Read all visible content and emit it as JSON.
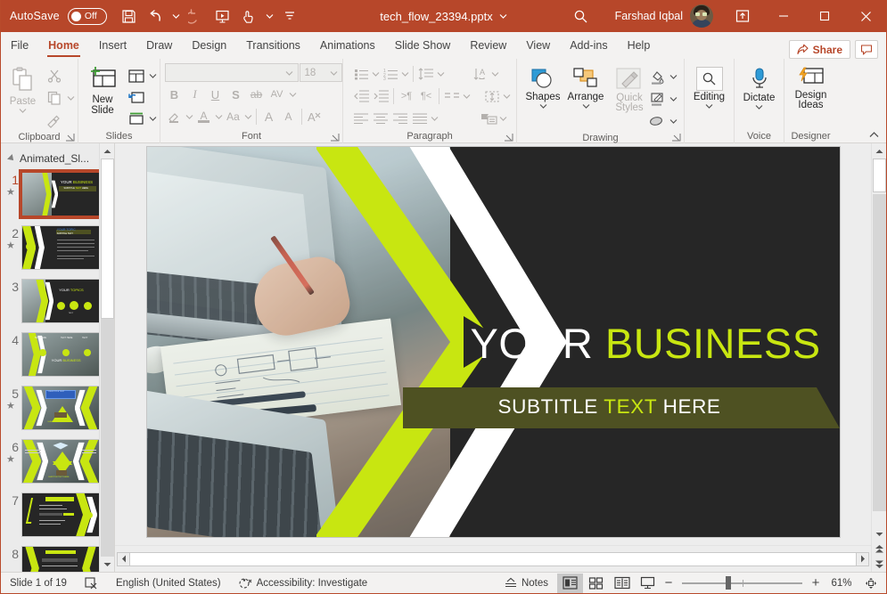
{
  "titlebar": {
    "autosave_label": "AutoSave",
    "autosave_state": "Off",
    "doc_title": "tech_flow_23394.pptx",
    "user_name": "Farshad Iqbal",
    "icons": [
      "save-icon",
      "undo-icon",
      "redo-icon",
      "start-slideshow-icon",
      "touch-mode-icon",
      "customize-qat-icon"
    ],
    "search_icon": "search-icon",
    "ribbon_display_icon": "ribbon-display-options-icon",
    "minimize_label": "—",
    "maximize_label": "☐",
    "close_label": "✕",
    "accent": "#b7472a"
  },
  "tabs": [
    {
      "label": "File",
      "active": false
    },
    {
      "label": "Home",
      "active": true
    },
    {
      "label": "Insert",
      "active": false
    },
    {
      "label": "Draw",
      "active": false
    },
    {
      "label": "Design",
      "active": false
    },
    {
      "label": "Transitions",
      "active": false
    },
    {
      "label": "Animations",
      "active": false
    },
    {
      "label": "Slide Show",
      "active": false
    },
    {
      "label": "Review",
      "active": false
    },
    {
      "label": "View",
      "active": false
    },
    {
      "label": "Add-ins",
      "active": false
    },
    {
      "label": "Help",
      "active": false
    }
  ],
  "tabbar_right": {
    "share_label": "Share",
    "comment_icon": "comment-icon"
  },
  "ribbon": {
    "clipboard": {
      "label": "Clipboard",
      "paste_label": "Paste",
      "cut_icon": "scissors-icon",
      "copy_icon": "copy-icon",
      "format_painter_icon": "format-painter-icon",
      "disabled": true
    },
    "slides": {
      "label": "Slides",
      "new_slide_label": "New Slide",
      "layout_icon": "slide-layout-icon",
      "reset_icon": "reset-slide-icon",
      "section_icon": "section-icon"
    },
    "font": {
      "label": "Font",
      "font_name": "",
      "font_name_placeholder": "",
      "font_size": "18",
      "bold": "B",
      "italic": "I",
      "underline": "U",
      "shadow": "S",
      "strikethrough": "ab",
      "char_spacing": "AV",
      "text_highlight_icon": "text-highlight-icon",
      "font_color_icon": "font-color-icon",
      "change_case": "Aa",
      "increase_size": "A",
      "decrease_size": "A",
      "clear_formatting_icon": "clear-formatting-icon",
      "disabled": true
    },
    "paragraph": {
      "label": "Paragraph",
      "bullets_icon": "bullets-icon",
      "numbering_icon": "numbering-icon",
      "line_spacing_icon": "line-spacing-icon",
      "text_direction_icon": "text-direction-icon",
      "decrease_indent_icon": "decrease-indent-icon",
      "increase_indent_icon": "increase-indent-icon",
      "rtl_icon": "rtl-icon",
      "ltr_icon": "ltr-icon",
      "columns_icon": "columns-icon",
      "align_text_icon": "align-text-icon",
      "align_left_icon": "align-left-icon",
      "align_center_icon": "align-center-icon",
      "align_right_icon": "align-right-icon",
      "justify_icon": "justify-icon",
      "smartart_icon": "convert-to-smartart-icon",
      "disabled": true
    },
    "drawing": {
      "label": "Drawing",
      "shapes_label": "Shapes",
      "arrange_label": "Arrange",
      "quick_styles_label": "Quick Styles",
      "shape_fill_icon": "shape-fill-icon",
      "shape_outline_icon": "shape-outline-icon",
      "shape_effects_icon": "shape-effects-icon"
    },
    "voice": {
      "label": "Voice",
      "dictate_label": "Dictate"
    },
    "designer": {
      "label": "Designer",
      "design_ideas_label": "Design Ideas"
    },
    "editing": {
      "label": "Editing"
    },
    "collapse_icon": "collapse-ribbon-icon"
  },
  "thumbnails": {
    "section_name": "Animated_Sl...",
    "section_collapse_icon": "section-collapse-icon",
    "slides": [
      {
        "num": "1",
        "animated": true,
        "selected": true,
        "type": "title"
      },
      {
        "num": "2",
        "animated": true,
        "selected": false,
        "type": "content-left"
      },
      {
        "num": "3",
        "animated": false,
        "selected": false,
        "type": "three-circles"
      },
      {
        "num": "4",
        "animated": false,
        "selected": false,
        "type": "four-circles"
      },
      {
        "num": "5",
        "animated": true,
        "selected": false,
        "type": "triangle"
      },
      {
        "num": "6",
        "animated": true,
        "selected": false,
        "type": "hourglass"
      },
      {
        "num": "7",
        "animated": false,
        "selected": false,
        "type": "list"
      },
      {
        "num": "8",
        "animated": true,
        "selected": false,
        "type": "list2"
      }
    ],
    "scroll_up_icon": "scroll-up-icon",
    "scroll_down_icon": "scroll-down-icon"
  },
  "slide": {
    "title_part1": "YOUR ",
    "title_part2": "BUSINESS",
    "subtitle_part1": "SUBTITLE ",
    "subtitle_part2": "TEXT",
    "subtitle_part3": " HERE",
    "colors": {
      "background": "#262626",
      "accent_green": "#c8e611",
      "band": "#4e5122",
      "white": "#ffffff"
    }
  },
  "status": {
    "slide_indicator": "Slide 1 of 19",
    "notes_icon_label": "notes-icon",
    "language": "English (United States)",
    "language_icon": "spellcheck-icon",
    "accessibility": "Accessibility: Investigate",
    "accessibility_icon": "accessibility-icon",
    "notes_label": "Notes",
    "views": [
      {
        "name": "normal-view",
        "active": true
      },
      {
        "name": "slide-sorter-view",
        "active": false
      },
      {
        "name": "reading-view",
        "active": false
      },
      {
        "name": "slide-show-view",
        "active": false
      }
    ],
    "zoom_out_label": "−",
    "zoom_in_label": "+",
    "zoom_level": "61%",
    "fit_icon": "fit-to-window-icon"
  }
}
